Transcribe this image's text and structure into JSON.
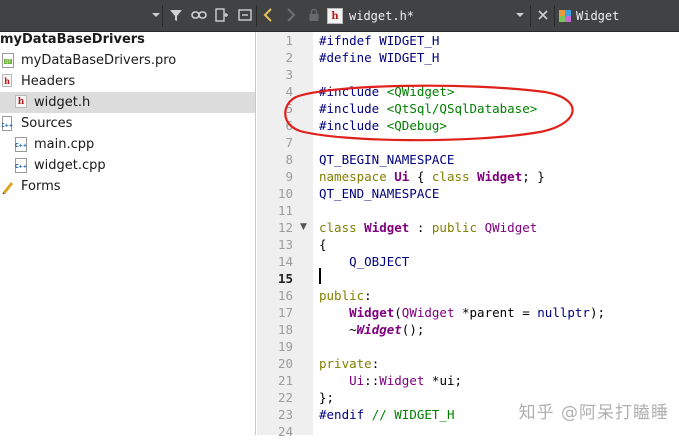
{
  "toolbar": {
    "file_name": "widget.h*",
    "symbol_name": "Widget",
    "icons": [
      "dropdown-icon",
      "filter-icon",
      "link-icon",
      "split-add-icon",
      "close-panel-icon",
      "back-icon",
      "forward-icon",
      "lock-icon",
      "file-h-icon",
      "dropdown-icon",
      "close-icon",
      "class-icon"
    ]
  },
  "tree": {
    "project": "myDataBaseDrivers",
    "items": [
      {
        "label": "myDataBaseDrivers.pro",
        "icon": "pro-file-icon"
      },
      {
        "label": "Headers",
        "icon": "headers-folder-icon"
      },
      {
        "label": "widget.h",
        "icon": "header-file-icon"
      },
      {
        "label": "Sources",
        "icon": "sources-folder-icon"
      },
      {
        "label": "main.cpp",
        "icon": "cpp-file-icon"
      },
      {
        "label": "widget.cpp",
        "icon": "cpp-file-icon"
      },
      {
        "label": "Forms",
        "icon": "forms-folder-icon"
      }
    ]
  },
  "editor": {
    "current_line": "15",
    "line_numbers": [
      "1",
      "2",
      "3",
      "4",
      "5",
      "6",
      "7",
      "8",
      "9",
      "10",
      "11",
      "12",
      "13",
      "14",
      "15",
      "16",
      "17",
      "18",
      "19",
      "20",
      "21",
      "22",
      "23",
      "24"
    ],
    "lines": [
      "#ifndef WIDGET_H",
      "#define WIDGET_H",
      "",
      "#include <QWidget>",
      "#include <QtSql/QSqlDatabase>",
      "#include <QDebug>",
      "",
      "QT_BEGIN_NAMESPACE",
      "namespace Ui { class Widget; }",
      "QT_END_NAMESPACE",
      "",
      "class Widget : public QWidget",
      "{",
      "    Q_OBJECT",
      "",
      "public:",
      "    Widget(QWidget *parent = nullptr);",
      "    ~Widget();",
      "",
      "private:",
      "    Ui::Widget *ui;",
      "};",
      "#endif // WIDGET_H",
      ""
    ]
  },
  "watermark": "知乎 @阿呆打瞌睡",
  "colors": {
    "toolbar_bg": "#404244",
    "annotation": "#e0201b",
    "keyword": "#808000",
    "class": "#800080",
    "include_path": "#008000",
    "preprocessor": "#000080"
  }
}
